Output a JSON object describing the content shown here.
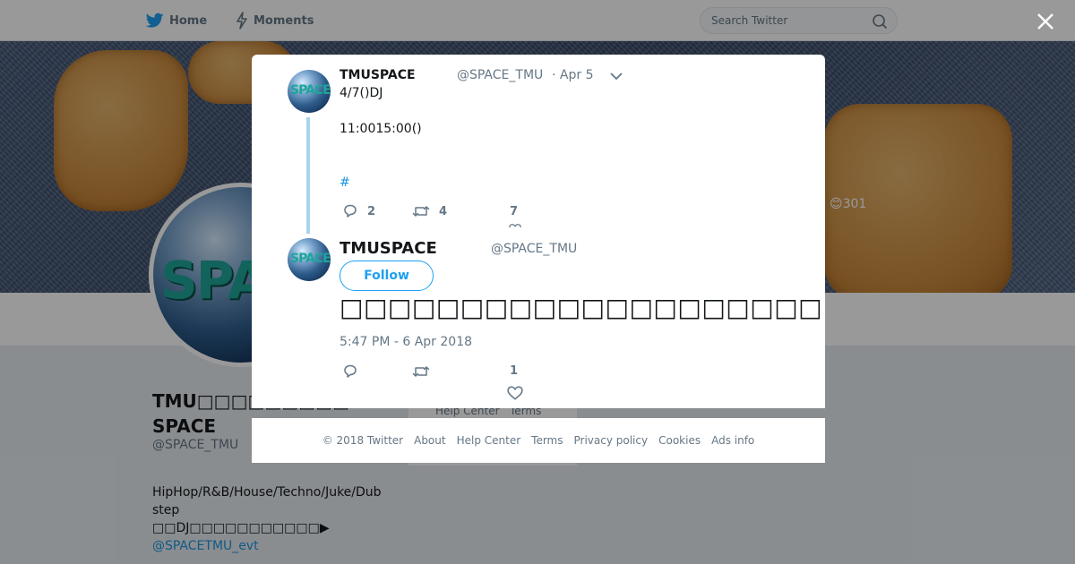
{
  "nav": {
    "home_label": "Home",
    "moments_label": "Moments",
    "search_placeholder": "Search Twitter"
  },
  "banner": {
    "emoji_count": "😊301"
  },
  "profile": {
    "name": "TMU□□□□□□□□□ SPACE",
    "handle": "@SPACE_TMU",
    "bio_line1": "HipHop/R&B/House/Techno/Juke/Dub step",
    "bio_line2": "□□DJ□□□□□□□□□□□▶",
    "bio_link": "@SPACETMU_evt"
  },
  "background_footer": {
    "help_center": "Help Center",
    "terms": "Terms"
  },
  "tweet1": {
    "name": "TMUSPACE",
    "handle": "@SPACE_TMU",
    "date": "· Apr 5",
    "text_line1": "4/7()DJ",
    "text_line2": "11:0015:00()",
    "hashtag": "#",
    "reply_count": "2",
    "retweet_count": "4",
    "like_count": "7"
  },
  "tweet2": {
    "name": "TMUSPACE",
    "handle": "@SPACE_TMU",
    "follow_label": "Follow",
    "text": "□□□□□□□□□□□□□□□□□□□□",
    "timestamp": "5:47 PM - 6 Apr 2018",
    "like_count": "1"
  },
  "footer": {
    "copyright": "© 2018 Twitter",
    "about": "About",
    "help_center": "Help Center",
    "terms": "Terms",
    "privacy": "Privacy policy",
    "cookies": "Cookies",
    "ads_info": "Ads info"
  },
  "colors": {
    "accent": "#1da1f2",
    "link": "#1b95e0",
    "muted": "#657786"
  }
}
